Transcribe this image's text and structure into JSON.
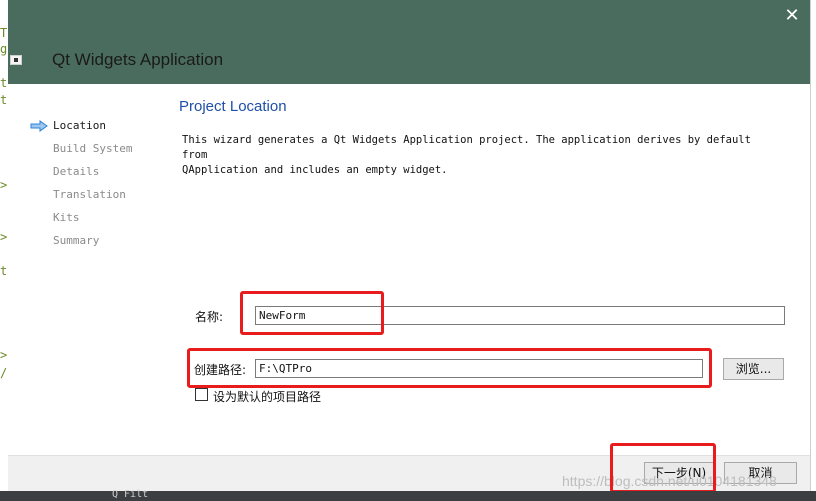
{
  "background_editor": {
    "fragments": [
      "T",
      "g",
      "t",
      "t",
      ">",
      ">",
      "t",
      ">",
      "/"
    ]
  },
  "window": {
    "title": "Qt Widgets Application",
    "close_glyph": "✕",
    "titlebar_color": "#4a6c5f"
  },
  "sidebar": {
    "steps": [
      {
        "label": "Location",
        "active": true
      },
      {
        "label": "Build System",
        "active": false
      },
      {
        "label": "Details",
        "active": false
      },
      {
        "label": "Translation",
        "active": false
      },
      {
        "label": "Kits",
        "active": false
      },
      {
        "label": "Summary",
        "active": false
      }
    ],
    "arrow_icon": "arrow-right-icon",
    "arrow_color": "#2f80d8"
  },
  "main": {
    "title": "Project Location",
    "description_line1": "This wizard generates a Qt Widgets Application project. The application derives by default from",
    "description_line2": "QApplication and includes an empty widget.",
    "name_label": "名称:",
    "name_value": "NewForm",
    "path_label": "创建路径:",
    "path_value": "F:\\QTPro",
    "browse_label": "浏览...",
    "default_path_label": "设为默认的项目路径",
    "default_path_checked": false
  },
  "footer": {
    "next_label": "下一步(N)",
    "cancel_label": "取消",
    "watermark": "https://blog.csdn.net/u0104181348"
  },
  "taskbar": {
    "text": "Q Filt"
  },
  "annotation_color": "#e81c1c"
}
